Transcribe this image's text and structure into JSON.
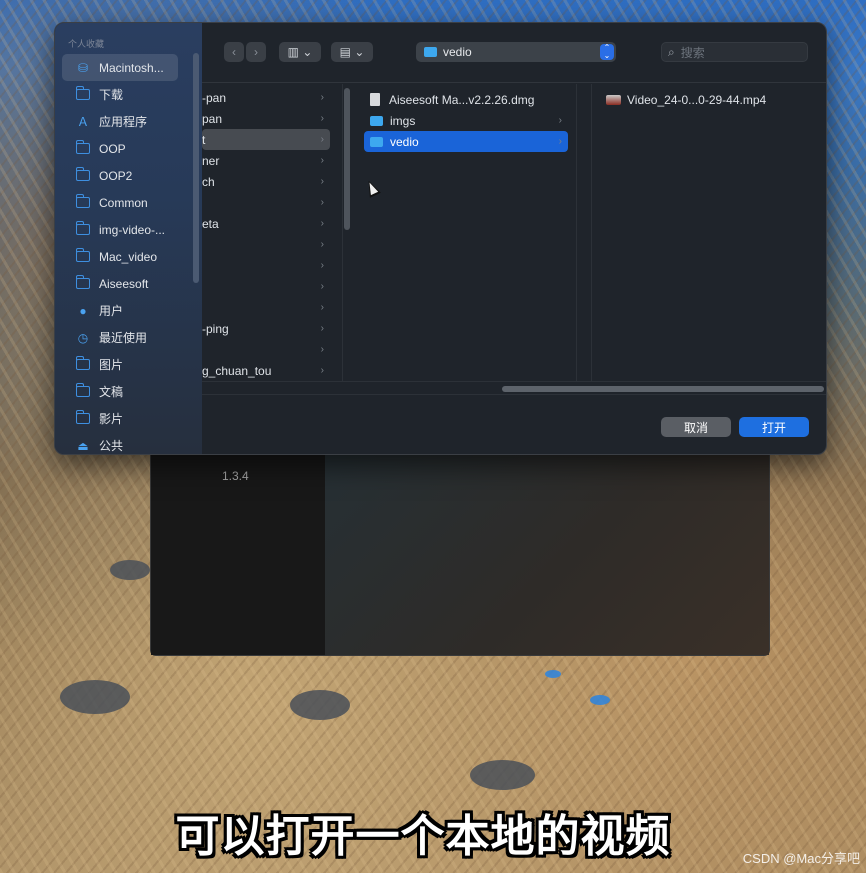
{
  "background": {
    "description": "coral reef with fish"
  },
  "back_window": {
    "version": "1.3.4"
  },
  "dialog": {
    "sidebar": {
      "header": "个人收藏",
      "items": [
        {
          "label": "Macintosh...",
          "icon": "hard-drive-icon",
          "active": true
        },
        {
          "label": "下载",
          "icon": "folder-icon"
        },
        {
          "label": "应用程序",
          "icon": "applications-icon"
        },
        {
          "label": "OOP",
          "icon": "folder-icon"
        },
        {
          "label": "OOP2",
          "icon": "folder-icon"
        },
        {
          "label": "Common",
          "icon": "folder-icon"
        },
        {
          "label": "img-video-...",
          "icon": "folder-icon"
        },
        {
          "label": "Mac_video",
          "icon": "folder-icon"
        },
        {
          "label": "Aiseesoft",
          "icon": "folder-icon"
        },
        {
          "label": "用户",
          "icon": "user-icon"
        },
        {
          "label": "最近使用",
          "icon": "clock-icon"
        },
        {
          "label": "图片",
          "icon": "folder-icon"
        },
        {
          "label": "文稿",
          "icon": "folder-icon"
        },
        {
          "label": "影片",
          "icon": "folder-icon"
        },
        {
          "label": "公共",
          "icon": "shared-drive-icon"
        }
      ]
    },
    "toolbar": {
      "back_icon": "‹",
      "forward_icon": "›",
      "view_icon": "▥",
      "group_icon": "▤",
      "chevron": "⌄",
      "path_label": "vedio",
      "path_stepper": "⌃⌄",
      "search_placeholder": "搜索",
      "search_icon": "⌕"
    },
    "columns": {
      "col1": [
        {
          "label": "-pan"
        },
        {
          "label": "pan"
        },
        {
          "label": "t",
          "selected": true
        },
        {
          "label": "ner"
        },
        {
          "label": "ch"
        },
        {
          "label": ""
        },
        {
          "label": "eta"
        },
        {
          "label": ""
        },
        {
          "label": ""
        },
        {
          "label": ""
        },
        {
          "label": ""
        },
        {
          "label": "-ping"
        },
        {
          "label": ""
        },
        {
          "label": "g_chuan_tou"
        }
      ],
      "col2": [
        {
          "label": "Aiseesoft Ma...v2.2.26.dmg",
          "type": "dmg"
        },
        {
          "label": "imgs",
          "type": "folder"
        },
        {
          "label": "vedio",
          "type": "folder",
          "selected": true
        }
      ],
      "col3": [
        {
          "label": "Video_24-0...0-29-44.mp4",
          "type": "video"
        }
      ]
    },
    "buttons": {
      "cancel": "取消",
      "open": "打开"
    }
  },
  "subtitle": "可以打开一个本地的视频",
  "watermark": "CSDN @Mac分享吧",
  "colors": {
    "accent": "#1e6fe0",
    "selection": "#1a64d8",
    "sidebar": "#273a58",
    "dialog_bg": "#1f242b"
  }
}
